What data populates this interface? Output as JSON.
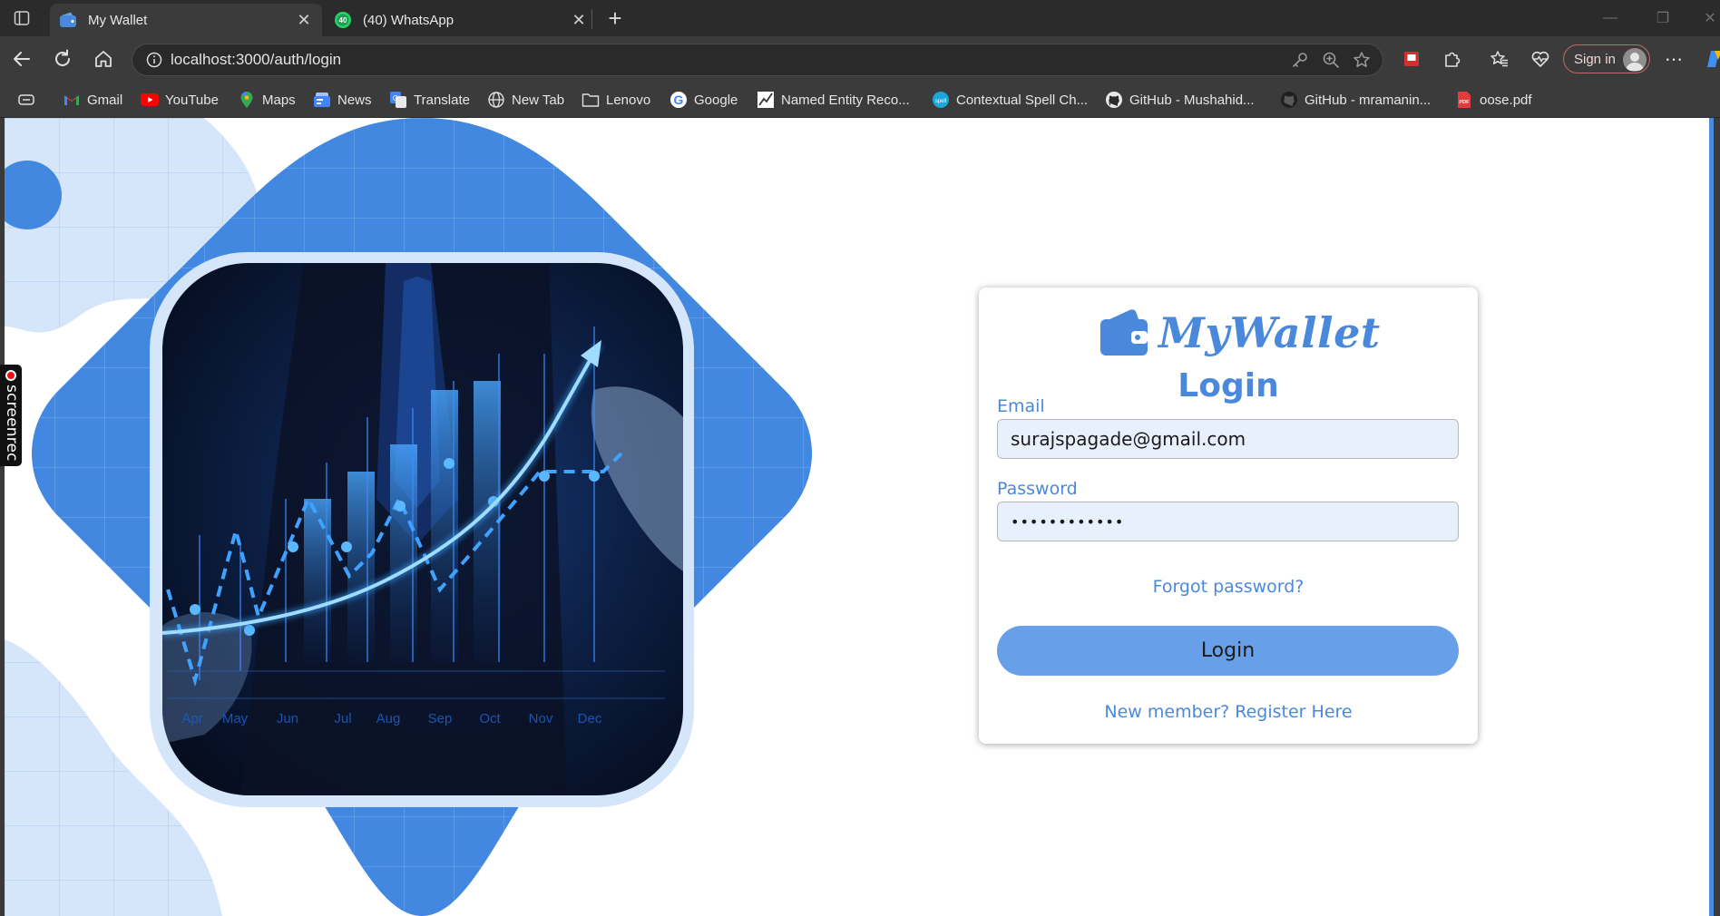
{
  "browser": {
    "tabs": [
      {
        "title": "My Wallet",
        "active": true,
        "icon": "wallet-favicon"
      },
      {
        "title": "(40) WhatsApp",
        "active": false,
        "icon": "whatsapp-favicon",
        "badge": "40"
      }
    ],
    "url": "localhost:3000/auth/login",
    "signin_label": "Sign in",
    "bookmarks": [
      {
        "label": "Gmail",
        "icon": "gmail-icon"
      },
      {
        "label": "YouTube",
        "icon": "youtube-icon"
      },
      {
        "label": "Maps",
        "icon": "maps-icon"
      },
      {
        "label": "News",
        "icon": "news-icon"
      },
      {
        "label": "Translate",
        "icon": "translate-icon"
      },
      {
        "label": "New Tab",
        "icon": "globe-icon"
      },
      {
        "label": "Lenovo",
        "icon": "folder-icon"
      },
      {
        "label": "Google",
        "icon": "google-icon"
      },
      {
        "label": "Named Entity Reco...",
        "icon": "chart-icon"
      },
      {
        "label": "Contextual Spell Ch...",
        "icon": "spell-icon"
      },
      {
        "label": "GitHub - Mushahid...",
        "icon": "github-icon"
      },
      {
        "label": "GitHub - mramanin...",
        "icon": "github-icon"
      },
      {
        "label": "oose.pdf",
        "icon": "pdf-icon"
      }
    ]
  },
  "hero": {
    "months": [
      "Apr",
      "May",
      "Jun",
      "Jul",
      "Aug",
      "Sep",
      "Oct",
      "Nov",
      "Dec"
    ]
  },
  "recorder": {
    "label": "screenrec"
  },
  "login": {
    "brand": "MyWallet",
    "heading": "Login",
    "email_label": "Email",
    "email_value": "surajspagade@gmail.com",
    "password_label": "Password",
    "password_value": "••••••••••••",
    "forgot": "Forgot password?",
    "submit": "Login",
    "register": "New member? Register Here"
  },
  "colors": {
    "brand_blue": "#4a88dc",
    "button_blue": "#67a0e8",
    "hero_blue": "#4388e0",
    "hero_light": "#d5e6fb",
    "input_bg": "#e8f0fe"
  }
}
